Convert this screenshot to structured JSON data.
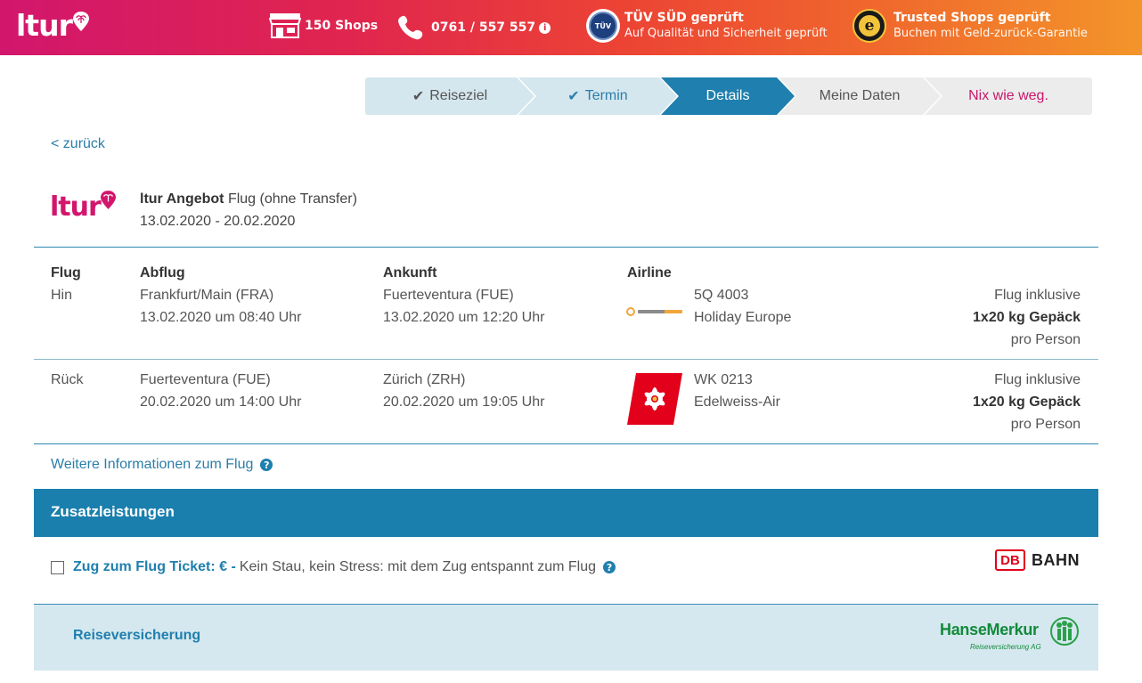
{
  "header": {
    "logo_text": "ltur",
    "shops_label": "150 Shops",
    "phone": "0761 / 557 557",
    "tuev_title": "TÜV SÜD geprüft",
    "tuev_sub": "Auf Qualität und Sicherheit geprüft",
    "trusted_title": "Trusted Shops geprüft",
    "trusted_sub": "Buchen mit Geld-zurück-Garantie",
    "colors": {
      "gradient_start": "#d2166d",
      "gradient_end": "#f3952a"
    }
  },
  "steps": [
    {
      "label": "Reiseziel",
      "done": true
    },
    {
      "label": "Termin",
      "done": true
    },
    {
      "label": "Details",
      "active": true
    },
    {
      "label": "Meine Daten"
    },
    {
      "label": "Nix wie weg."
    }
  ],
  "back_link": "< zurück",
  "offer": {
    "brand": "ltur",
    "title_bold": "ltur Angebot",
    "title_rest": " Flug (ohne Transfer)",
    "dates": "13.02.2020 - 20.02.2020"
  },
  "flights": {
    "headers": {
      "flug": "Flug",
      "abflug": "Abflug",
      "ankunft": "Ankunft",
      "airline": "Airline"
    },
    "rows": [
      {
        "dir": "Hin",
        "dep_airport": "Frankfurt/Main (FRA)",
        "dep_time": "13.02.2020 um 08:40 Uhr",
        "arr_airport": "Fuerteventura (FUE)",
        "arr_time": "13.02.2020 um 12:20 Uhr",
        "airline_logo": "holiday-europe-logo",
        "flight_no": "5Q 4003",
        "airline": "Holiday Europe",
        "incl": "Flug inklusive",
        "baggage": "1x20 kg Gepäck",
        "per": "pro Person"
      },
      {
        "dir": "Rück",
        "dep_airport": "Fuerteventura (FUE)",
        "dep_time": "20.02.2020 um 14:00 Uhr",
        "arr_airport": "Zürich (ZRH)",
        "arr_time": "20.02.2020 um 19:05 Uhr",
        "airline_logo": "edelweiss-logo",
        "flight_no": "WK 0213",
        "airline": "Edelweiss-Air",
        "incl": "Flug inklusive",
        "baggage": "1x20 kg Gepäck",
        "per": "pro Person"
      }
    ]
  },
  "more_info": "Weitere Informationen zum Flug",
  "extras": {
    "title": "Zusatzleistungen",
    "zug_link": "Zug zum Flug Ticket: € -",
    "zug_desc": "Kein Stau, kein Stress: mit dem Zug entspannt zum Flug",
    "db_mark": "DB",
    "db_text": "BAHN"
  },
  "insurance": {
    "label": "Reiseversicherung",
    "brand": "HanseMerkur",
    "brand_sub": "Reiseversicherung AG"
  },
  "question_mark": "?"
}
